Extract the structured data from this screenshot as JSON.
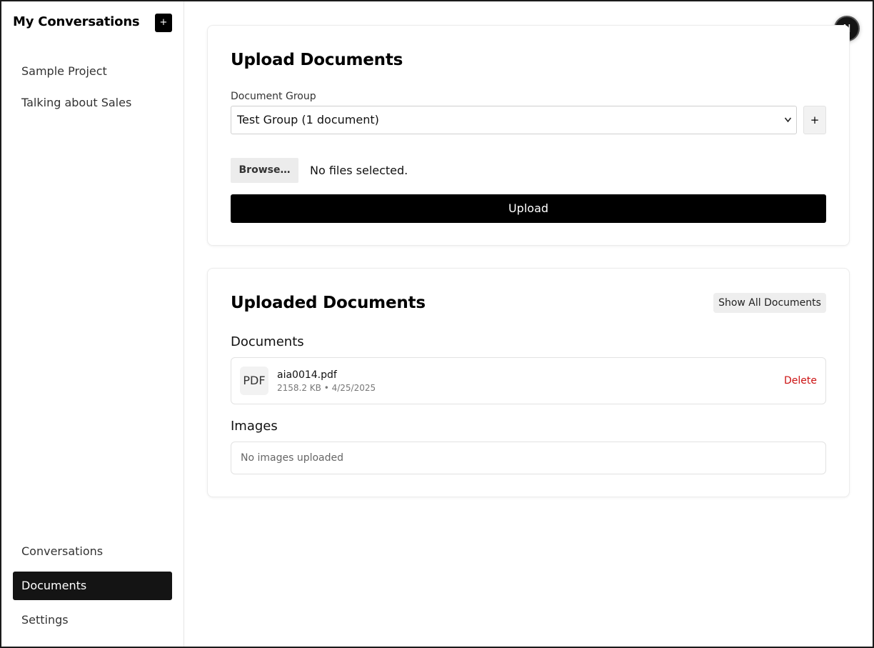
{
  "sidebar": {
    "title": "My Conversations",
    "new_button": "+",
    "conversations": [
      "Sample Project",
      "Talking about Sales"
    ],
    "nav": [
      {
        "label": "Conversations",
        "active": false
      },
      {
        "label": "Documents",
        "active": true
      },
      {
        "label": "Settings",
        "active": false
      }
    ]
  },
  "avatar": {
    "initial": "N"
  },
  "upload_card": {
    "title": "Upload Documents",
    "group_label": "Document Group",
    "group_selected": "Test Group (1 document)",
    "add_group_button": "+",
    "browse_button": "Browse…",
    "file_status": "No files selected.",
    "upload_button": "Upload"
  },
  "docs_card": {
    "title": "Uploaded Documents",
    "show_all_button": "Show All Documents",
    "documents_heading": "Documents",
    "documents": [
      {
        "type": "PDF",
        "name": "aia0014.pdf",
        "meta": "2158.2 KB • 4/25/2025",
        "action": "Delete"
      }
    ],
    "images_heading": "Images",
    "images_empty": "No images uploaded"
  },
  "colors": {
    "accent": "#000000",
    "active_nav": "#141414",
    "danger": "#cc1111"
  }
}
